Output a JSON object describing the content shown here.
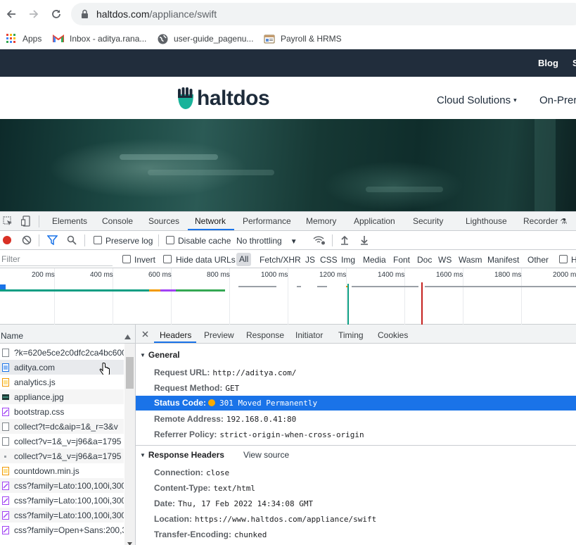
{
  "browser": {
    "url_host": "haltdos.com",
    "url_path": "/appliance/swift",
    "bookmarks": [
      {
        "label": "Apps",
        "icon": "apps-grid-icon"
      },
      {
        "label": "Inbox - aditya.rana...",
        "icon": "gmail-icon"
      },
      {
        "label": "user-guide_pagenu...",
        "icon": "globe-icon"
      },
      {
        "label": "Payroll & HRMS",
        "icon": "payroll-icon"
      }
    ]
  },
  "page": {
    "topnav": {
      "blog": "Blog",
      "cut": "S"
    },
    "logo_text": "haltdos",
    "menu": {
      "cloud": "Cloud Solutions",
      "onprem": "On-Prer"
    }
  },
  "devtools": {
    "tabs": [
      "Elements",
      "Console",
      "Sources",
      "Network",
      "Performance",
      "Memory",
      "Application",
      "Security",
      "Lighthouse",
      "Recorder"
    ],
    "active_tab": "Network",
    "toolbar": {
      "preserve_log": "Preserve log",
      "disable_cache": "Disable cache",
      "throttling": "No throttling"
    },
    "filter": {
      "placeholder": "Filter",
      "invert": "Invert",
      "hide_data_urls": "Hide data URLs",
      "types": [
        "All",
        "Fetch/XHR",
        "JS",
        "CSS",
        "Img",
        "Media",
        "Font",
        "Doc",
        "WS",
        "Wasm",
        "Manifest",
        "Other"
      ],
      "cut": "H"
    },
    "timeline": {
      "ticks": [
        "200 ms",
        "400 ms",
        "600 ms",
        "800 ms",
        "1000 ms",
        "1200 ms",
        "1400 ms",
        "1600 ms",
        "1800 ms",
        "2000 ms"
      ]
    },
    "requests": {
      "header": "Name",
      "rows": [
        {
          "name": "?k=620e5ce2c0dfc2ca4bc600",
          "type": "other"
        },
        {
          "name": "aditya.com",
          "type": "doc"
        },
        {
          "name": "analytics.js",
          "type": "js"
        },
        {
          "name": "appliance.jpg",
          "type": "img"
        },
        {
          "name": "bootstrap.css",
          "type": "css"
        },
        {
          "name": "collect?t=dc&aip=1&_r=3&v",
          "type": "other"
        },
        {
          "name": "collect?v=1&_v=j96&a=1795",
          "type": "other"
        },
        {
          "name": "collect?v=1&_v=j96&a=1795",
          "type": "ping"
        },
        {
          "name": "countdown.min.js",
          "type": "js"
        },
        {
          "name": "css?family=Lato:100,100i,300,",
          "type": "css"
        },
        {
          "name": "css?family=Lato:100,100i,300,",
          "type": "css"
        },
        {
          "name": "css?family=Lato:100,100i,300,",
          "type": "css"
        },
        {
          "name": "css?family=Open+Sans:200,3",
          "type": "css"
        }
      ]
    },
    "details": {
      "tabs": [
        "Headers",
        "Preview",
        "Response",
        "Initiator",
        "Timing",
        "Cookies"
      ],
      "active": "Headers",
      "general": {
        "title": "General",
        "request_url": {
          "k": "Request URL:",
          "v": "http://aditya.com/"
        },
        "request_method": {
          "k": "Request Method:",
          "v": "GET"
        },
        "status_code": {
          "k": "Status Code:",
          "v": "301 Moved Permanently"
        },
        "remote_address": {
          "k": "Remote Address:",
          "v": "192.168.0.41:80"
        },
        "referrer_policy": {
          "k": "Referrer Policy:",
          "v": "strict-origin-when-cross-origin"
        }
      },
      "response_headers": {
        "title": "Response Headers",
        "view_source": "View source",
        "connection": {
          "k": "Connection:",
          "v": "close"
        },
        "content_type": {
          "k": "Content-Type:",
          "v": "text/html"
        },
        "date": {
          "k": "Date:",
          "v": "Thu, 17 Feb 2022 14:34:08 GMT"
        },
        "location": {
          "k": "Location:",
          "v": "https://www.haltdos.com/appliance/swift"
        },
        "transfer_encoding": {
          "k": "Transfer-Encoding:",
          "v": "chunked"
        }
      }
    }
  }
}
